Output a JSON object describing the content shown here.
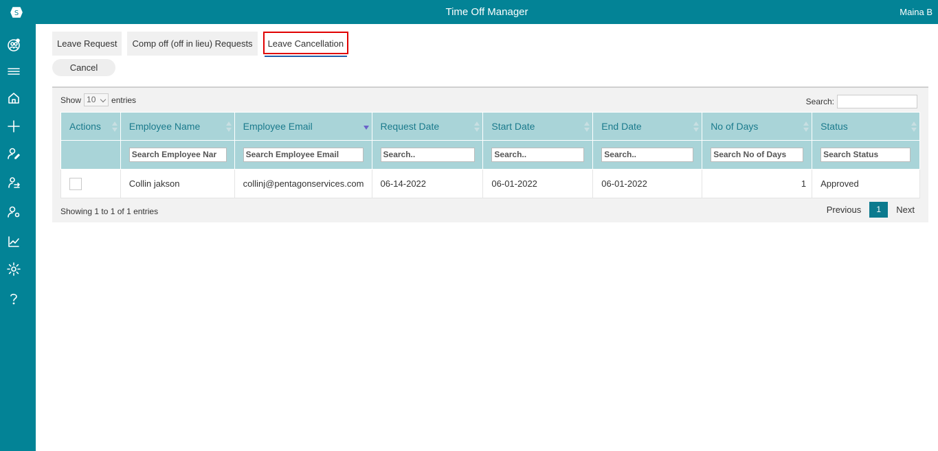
{
  "app": {
    "title": "Time Off Manager",
    "user": "Maina B"
  },
  "sidebar": {
    "items": [
      {
        "icon": "app-logo-icon"
      },
      {
        "icon": "team-icon"
      },
      {
        "icon": "menu-icon"
      },
      {
        "icon": "home-icon"
      },
      {
        "icon": "plus-icon"
      },
      {
        "icon": "user-edit-icon"
      },
      {
        "icon": "user-leave-icon"
      },
      {
        "icon": "user-settings-icon"
      },
      {
        "icon": "chart-icon"
      },
      {
        "icon": "gear-icon"
      },
      {
        "icon": "help-icon"
      }
    ]
  },
  "tabs": [
    {
      "label": "Leave Request"
    },
    {
      "label": "Comp off (off in lieu) Requests"
    },
    {
      "label": "Leave Cancellation",
      "active": true
    }
  ],
  "cancel_label": "Cancel",
  "table_controls": {
    "show_label": "Show",
    "page_size": "10",
    "entries_label": "entries",
    "search_label": "Search:"
  },
  "columns": [
    {
      "label": "Actions",
      "filter": ""
    },
    {
      "label": "Employee Name",
      "filter": "Search Employee Nar"
    },
    {
      "label": "Employee Email",
      "filter": "Search Employee Email"
    },
    {
      "label": "Request Date",
      "filter": "Search.."
    },
    {
      "label": "Start Date",
      "filter": "Search.."
    },
    {
      "label": "End Date",
      "filter": "Search.."
    },
    {
      "label": "No of Days",
      "filter": "Search No of Days"
    },
    {
      "label": "Status",
      "filter": "Search Status"
    }
  ],
  "rows": [
    {
      "name": "Collin jakson",
      "email": "collinj@pentagonservices.com",
      "request_date": "06-14-2022",
      "start_date": "06-01-2022",
      "end_date": "06-01-2022",
      "days": "1",
      "status": "Approved"
    }
  ],
  "footer": {
    "info": "Showing 1 to 1 of 1 entries",
    "previous": "Previous",
    "page": "1",
    "next": "Next"
  }
}
